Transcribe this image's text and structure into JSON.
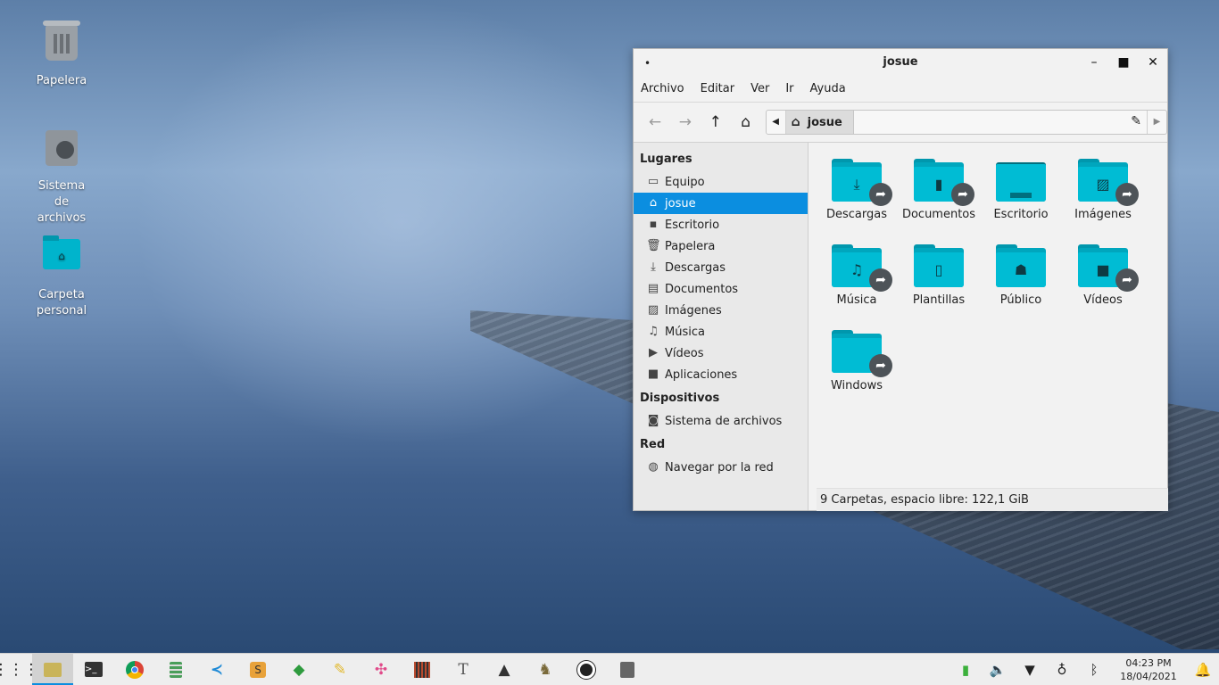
{
  "desktop": {
    "icons": [
      {
        "label": "Papelera",
        "icon": "trash-icon"
      },
      {
        "label": "Sistema de archivos",
        "icon": "drive-icon"
      },
      {
        "label": "Carpeta personal",
        "icon": "home-folder-icon"
      }
    ]
  },
  "window": {
    "title": "josue",
    "controls": {
      "minimize": "–",
      "maximize": "□",
      "close": "✕"
    },
    "menu": [
      "Archivo",
      "Editar",
      "Ver",
      "Ir",
      "Ayuda"
    ],
    "toolbar": {
      "back": "←",
      "forward": "→",
      "up": "↑",
      "home": "⌂",
      "path_crumb": "josue"
    },
    "sidebar": {
      "sections": [
        {
          "header": "Lugares",
          "items": [
            {
              "label": "Equipo",
              "icon": "computer-icon"
            },
            {
              "label": "josue",
              "icon": "home-icon",
              "active": true
            },
            {
              "label": "Escritorio",
              "icon": "desktop-icon"
            },
            {
              "label": "Papelera",
              "icon": "trash-icon"
            },
            {
              "label": "Descargas",
              "icon": "download-icon"
            },
            {
              "label": "Documentos",
              "icon": "document-icon"
            },
            {
              "label": "Imágenes",
              "icon": "image-icon"
            },
            {
              "label": "Música",
              "icon": "music-icon"
            },
            {
              "label": "Vídeos",
              "icon": "video-icon"
            },
            {
              "label": "Aplicaciones",
              "icon": "folder-icon"
            }
          ]
        },
        {
          "header": "Dispositivos",
          "items": [
            {
              "label": "Sistema de archivos",
              "icon": "drive-icon"
            }
          ]
        },
        {
          "header": "Red",
          "items": [
            {
              "label": "Navegar por la red",
              "icon": "globe-icon"
            }
          ]
        }
      ]
    },
    "files": [
      {
        "name": "Descargas",
        "icon": "download-folder-icon",
        "linked": true
      },
      {
        "name": "Documentos",
        "icon": "documents-folder-icon",
        "linked": true
      },
      {
        "name": "Escritorio",
        "icon": "desktop-folder-icon",
        "linked": false
      },
      {
        "name": "Imágenes",
        "icon": "pictures-folder-icon",
        "linked": true
      },
      {
        "name": "Música",
        "icon": "music-folder-icon",
        "linked": true
      },
      {
        "name": "Plantillas",
        "icon": "templates-folder-icon",
        "linked": false
      },
      {
        "name": "Público",
        "icon": "public-folder-icon",
        "linked": false
      },
      {
        "name": "Vídeos",
        "icon": "videos-folder-icon",
        "linked": true
      },
      {
        "name": "Windows",
        "icon": "folder-icon",
        "linked": true
      }
    ],
    "status": "9 Carpetas, espacio libre: 122,1 GiB"
  },
  "taskbar": {
    "apps": [
      {
        "name": "app-menu-icon"
      },
      {
        "name": "file-manager-icon",
        "active": true
      },
      {
        "name": "terminal-icon"
      },
      {
        "name": "chrome-icon"
      },
      {
        "name": "calculator-icon"
      },
      {
        "name": "vscode-icon"
      },
      {
        "name": "sublime-icon"
      },
      {
        "name": "git-icon"
      },
      {
        "name": "text-editor-icon"
      },
      {
        "name": "color-picker-icon"
      },
      {
        "name": "equalizer-icon"
      },
      {
        "name": "font-viewer-icon"
      },
      {
        "name": "inkscape-icon"
      },
      {
        "name": "gimp-icon"
      },
      {
        "name": "screenshot-icon"
      },
      {
        "name": "disk-app-icon"
      }
    ],
    "tray": [
      "battery-icon",
      "volume-icon",
      "wifi-icon",
      "lightbulb-icon",
      "bluetooth-icon"
    ],
    "clock": {
      "time": "04:23 PM",
      "date": "18/04/2021"
    },
    "notification": "bell-icon"
  },
  "colors": {
    "accent": "#0b8ee0",
    "folder": "#00bcd4"
  }
}
